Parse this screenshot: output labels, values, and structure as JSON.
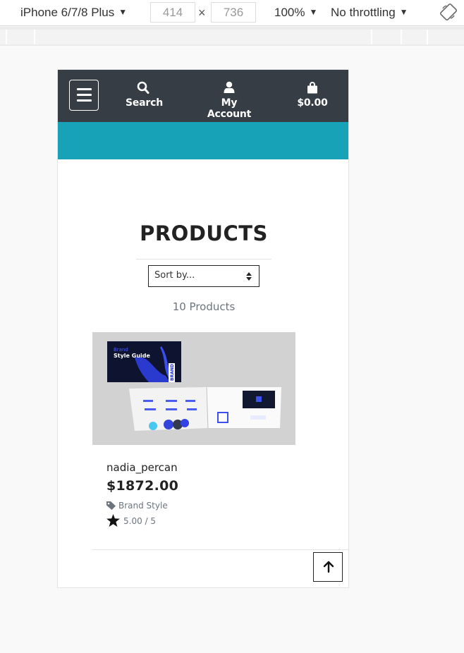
{
  "devtools": {
    "device": "iPhone 6/7/8 Plus",
    "width": "414",
    "height": "736",
    "zoom": "100%",
    "throttling": "No throttling",
    "times": "×"
  },
  "nav": {
    "search_label": "Search",
    "account_label": "My Account",
    "cart_label": "$0.00"
  },
  "page": {
    "title": "PRODUCTS",
    "sort_label": "Sort by...",
    "product_count": "10 Products"
  },
  "product": {
    "name": "nadia_percan",
    "price": "$1872.00",
    "category": "Brand Style",
    "rating": "5.00 / 5",
    "image_title_1": "Brand",
    "image_title_2": "Style Guide",
    "image_side_text": "BRAND"
  },
  "colors": {
    "nav_bg": "#363d45",
    "accent_teal": "#17a2b8"
  }
}
